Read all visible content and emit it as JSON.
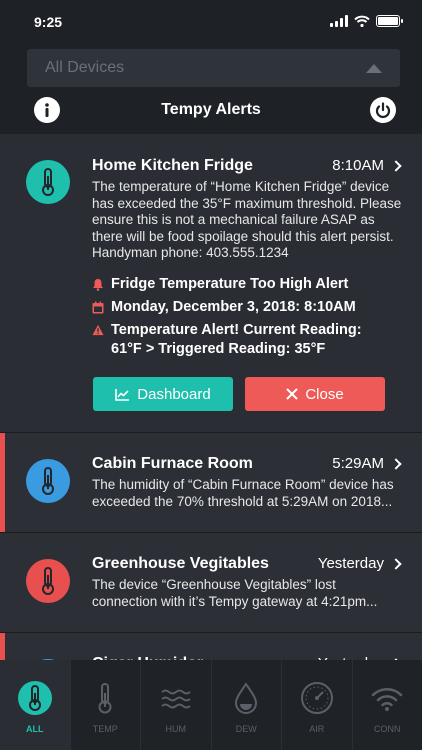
{
  "status": {
    "time": "9:25"
  },
  "header": {
    "device_select": {
      "value": "All Devices"
    },
    "title": "Tempy Alerts",
    "info_icon": "info-icon",
    "power_icon": "power-icon"
  },
  "alerts": [
    {
      "name": "Home Kitchen Fridge",
      "time": "8:10AM",
      "icon_color": "#1fbfad",
      "message": "The temperature of “Home Kitchen Fridge” device has exceeded the 35°F maximum threshold. Please ensure this is not a mechanical failure ASAP as there will be food spoilage should this alert persist. Handyman phone: 403.555.1234",
      "details": [
        {
          "icon": "bell-icon",
          "text": "Fridge Temperature Too High Alert"
        },
        {
          "icon": "calendar-icon",
          "text": "Monday, December 3, 2018: 8:10AM"
        },
        {
          "icon": "warning-icon",
          "text": "Temperature Alert! Current Reading: 61°F > Triggered Reading: 35°F"
        }
      ],
      "actions": {
        "dashboard": "Dashboard",
        "close": "Close"
      }
    },
    {
      "name": "Cabin Furnace Room",
      "time": "5:29AM",
      "icon_color": "#3b9be0",
      "message": "The humidity of “Cabin Furnace Room” device has exceeded the 70% threshold at 5:29AM on 2018..."
    },
    {
      "name": "Greenhouse Vegitables",
      "time": "Yesterday",
      "icon_color": "#e8504f",
      "message": "The device “Greenhouse Vegitables” lost connection with it’s Tempy gateway at 4:21pm..."
    },
    {
      "name": "Cigar Humidor",
      "time": "Yesterday",
      "icon_color": "#3b9be0",
      "message": ""
    }
  ],
  "tabs": [
    {
      "label": "ALL",
      "icon": "thermometer-circle-icon",
      "active": true
    },
    {
      "label": "TEMP",
      "icon": "thermometer-icon"
    },
    {
      "label": "HUM",
      "icon": "waves-icon"
    },
    {
      "label": "DEW",
      "icon": "droplet-icon"
    },
    {
      "label": "AIR",
      "icon": "gauge-icon"
    },
    {
      "label": "CONN",
      "icon": "wifi-icon"
    }
  ],
  "colors": {
    "accent": "#1fbfad",
    "danger": "#ee5a57",
    "background": "#23262b"
  }
}
